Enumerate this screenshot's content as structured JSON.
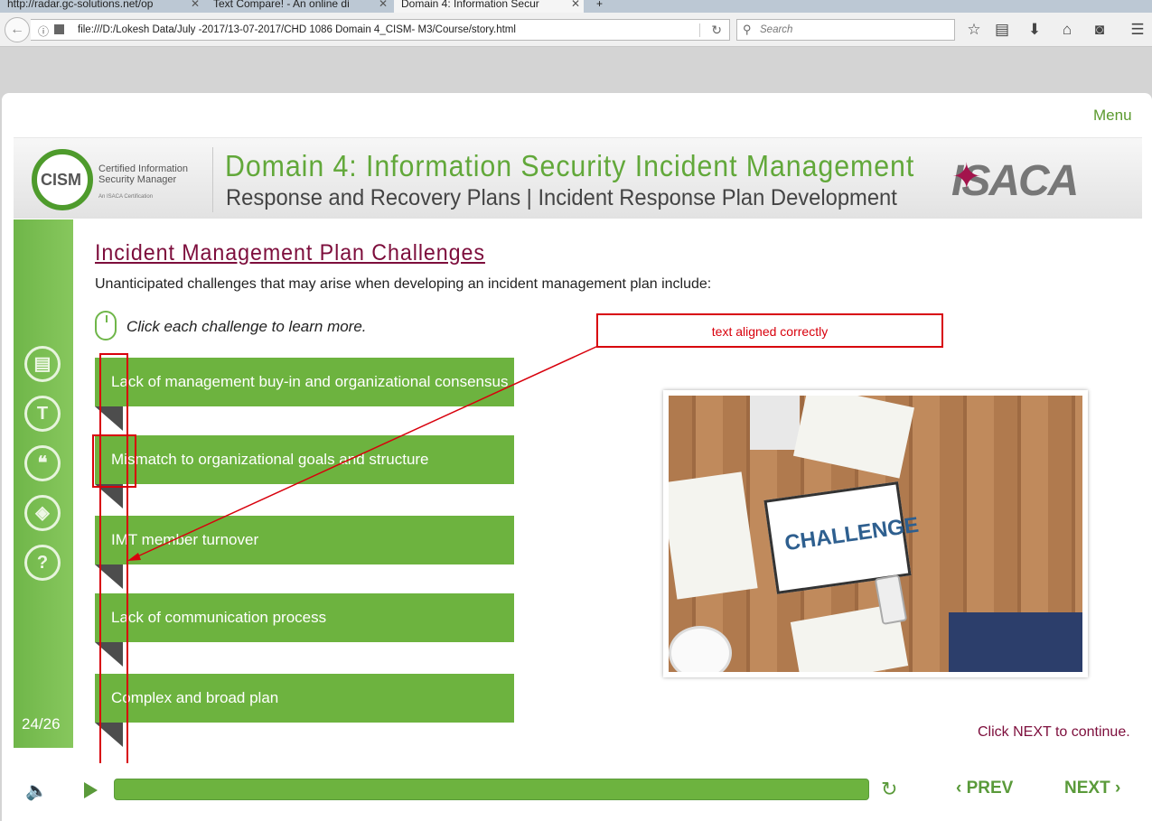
{
  "browser": {
    "tabs": [
      {
        "label": "http://radar.gc-solutions.net/op"
      },
      {
        "label": "Text Compare! - An online di"
      },
      {
        "label": "Domain 4: Information Secur"
      }
    ],
    "url": "file:///D:/Lokesh Data/July -2017/13-07-2017/CHD 1086 Domain 4_CISM- M3/Course/story.html",
    "search_placeholder": "Search"
  },
  "course": {
    "menu_label": "Menu",
    "logo": {
      "word": "CISM",
      "sub": "Certified Information Security Manager",
      "tag": "An ISACA Certification"
    },
    "title": "Domain 4: Information Security Incident Management",
    "subtitle": "Response and Recovery Plans | Incident Response Plan Development",
    "brand": "ISACA",
    "page_number": "24/26",
    "heading": "Incident Management Plan Challenges",
    "intro": "Unanticipated challenges that may arise when developing an incident management plan include:",
    "instruction": "Click each challenge to learn more.",
    "challenges": [
      "Lack of management buy-in and organizational consensus",
      "Mismatch to organizational goals and structure",
      "IMT member turnover",
      "Lack of communication process",
      "Complex and broad plan"
    ],
    "image_text": "CHALLENGE",
    "continue_text": "Click NEXT to continue.",
    "prev_label": "PREV",
    "next_label": "NEXT"
  },
  "annotation": {
    "text": "text aligned correctly",
    "color": "#d8000c"
  },
  "colors": {
    "accent_green": "#6db33f",
    "heading_maroon": "#7d0e3c"
  }
}
